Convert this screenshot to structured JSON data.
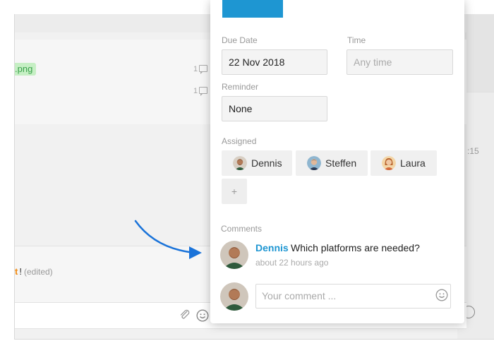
{
  "background_app": {
    "attachment": {
      "file_name": ".png",
      "comment_counts": [
        "1",
        "1"
      ]
    },
    "side_timestamp": ":15",
    "edited_message": {
      "highlight": "t",
      "bang": "!",
      "edited_label": "(edited)"
    }
  },
  "task_modal": {
    "due_date": {
      "label": "Due Date",
      "value": "22 Nov 2018"
    },
    "time": {
      "label": "Time",
      "placeholder": "Any time"
    },
    "reminder": {
      "label": "Reminder",
      "value": "None"
    },
    "assigned": {
      "label": "Assigned",
      "people": [
        "Dennis",
        "Steffen",
        "Laura"
      ],
      "add_label": "+"
    },
    "comments": {
      "label": "Comments",
      "items": [
        {
          "author": "Dennis",
          "text": "Which platforms are needed?",
          "time": "about 22 hours ago"
        }
      ],
      "input_placeholder": "Your comment ..."
    }
  },
  "colors": {
    "accent_blue": "#1e96d2",
    "file_green": "#3aa24b",
    "file_green_bg": "#c6efc4",
    "mention_orange": "#f08a12"
  }
}
